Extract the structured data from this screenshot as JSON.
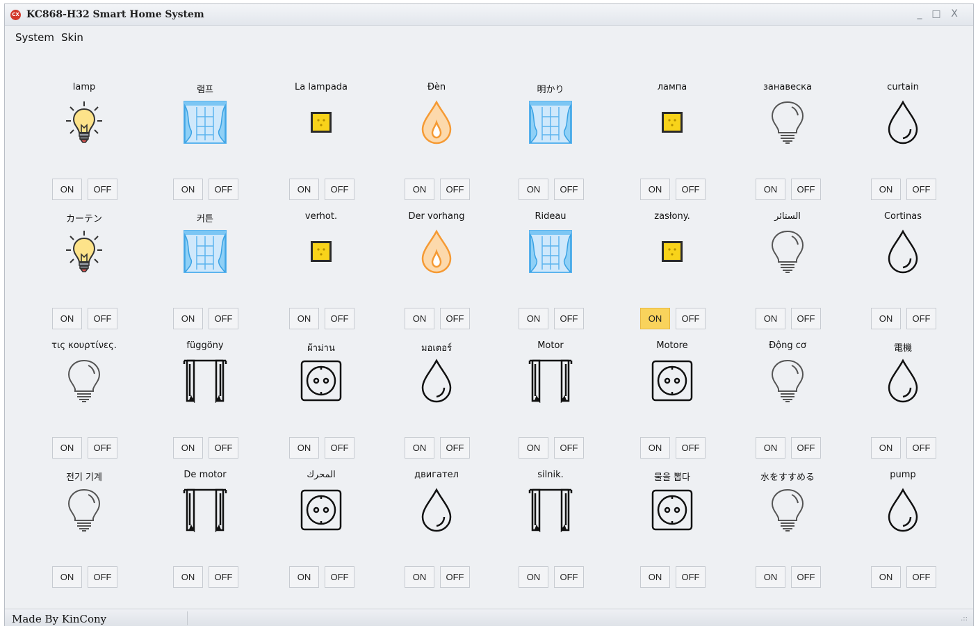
{
  "window": {
    "title": "KC868-H32 Smart Home System",
    "app_icon_text": "CX",
    "minimize": "_",
    "maximize": "□",
    "close": "X"
  },
  "menu": {
    "items": [
      "System",
      "Skin"
    ]
  },
  "buttons": {
    "on": "ON",
    "off": "OFF"
  },
  "active_color": "#f9d35c",
  "devices": [
    {
      "label": "lamp",
      "icon": "lightbulb-on-icon"
    },
    {
      "label": "램프",
      "icon": "curtain-window-icon"
    },
    {
      "label": "La lampada",
      "icon": "yellow-socket-icon"
    },
    {
      "label": "Đèn",
      "icon": "orange-drop-icon"
    },
    {
      "label": "明かり",
      "icon": "curtain-window-icon"
    },
    {
      "label": "лампа",
      "icon": "yellow-socket-icon"
    },
    {
      "label": "занавеска",
      "icon": "lightbulb-outline-icon"
    },
    {
      "label": "curtain",
      "icon": "water-drop-icon"
    },
    {
      "label": "カーテン",
      "icon": "lightbulb-on-icon"
    },
    {
      "label": "커튼",
      "icon": "curtain-window-icon"
    },
    {
      "label": "verhot.",
      "icon": "yellow-socket-icon"
    },
    {
      "label": "Der vorhang",
      "icon": "orange-drop-icon"
    },
    {
      "label": "Rideau",
      "icon": "curtain-window-icon"
    },
    {
      "label": "zasłony.",
      "icon": "yellow-socket-icon",
      "on_active": true
    },
    {
      "label": "الستائر",
      "icon": "lightbulb-outline-icon"
    },
    {
      "label": "Cortinas",
      "icon": "water-drop-icon"
    },
    {
      "label": "τις κουρτίνες.",
      "icon": "lightbulb-outline-icon"
    },
    {
      "label": "függöny",
      "icon": "curtain-icon"
    },
    {
      "label": "ผ้าม่าน",
      "icon": "power-socket-icon"
    },
    {
      "label": "มอเตอร์",
      "icon": "water-drop-icon"
    },
    {
      "label": "Motor",
      "icon": "curtain-icon"
    },
    {
      "label": "Motore",
      "icon": "power-socket-icon"
    },
    {
      "label": "Động cơ",
      "icon": "lightbulb-outline-icon"
    },
    {
      "label": "電機",
      "icon": "water-drop-icon"
    },
    {
      "label": "전기 기계",
      "icon": "lightbulb-outline-icon"
    },
    {
      "label": "De motor",
      "icon": "curtain-icon"
    },
    {
      "label": "المحرك",
      "icon": "power-socket-icon"
    },
    {
      "label": "двигател",
      "icon": "water-drop-icon"
    },
    {
      "label": "silnik.",
      "icon": "curtain-icon"
    },
    {
      "label": "물을 뽑다",
      "icon": "power-socket-icon"
    },
    {
      "label": "水をすすめる",
      "icon": "lightbulb-outline-icon"
    },
    {
      "label": "pump",
      "icon": "water-drop-icon"
    }
  ],
  "status": {
    "text": "Made By KinCony",
    "grip": ".::"
  }
}
